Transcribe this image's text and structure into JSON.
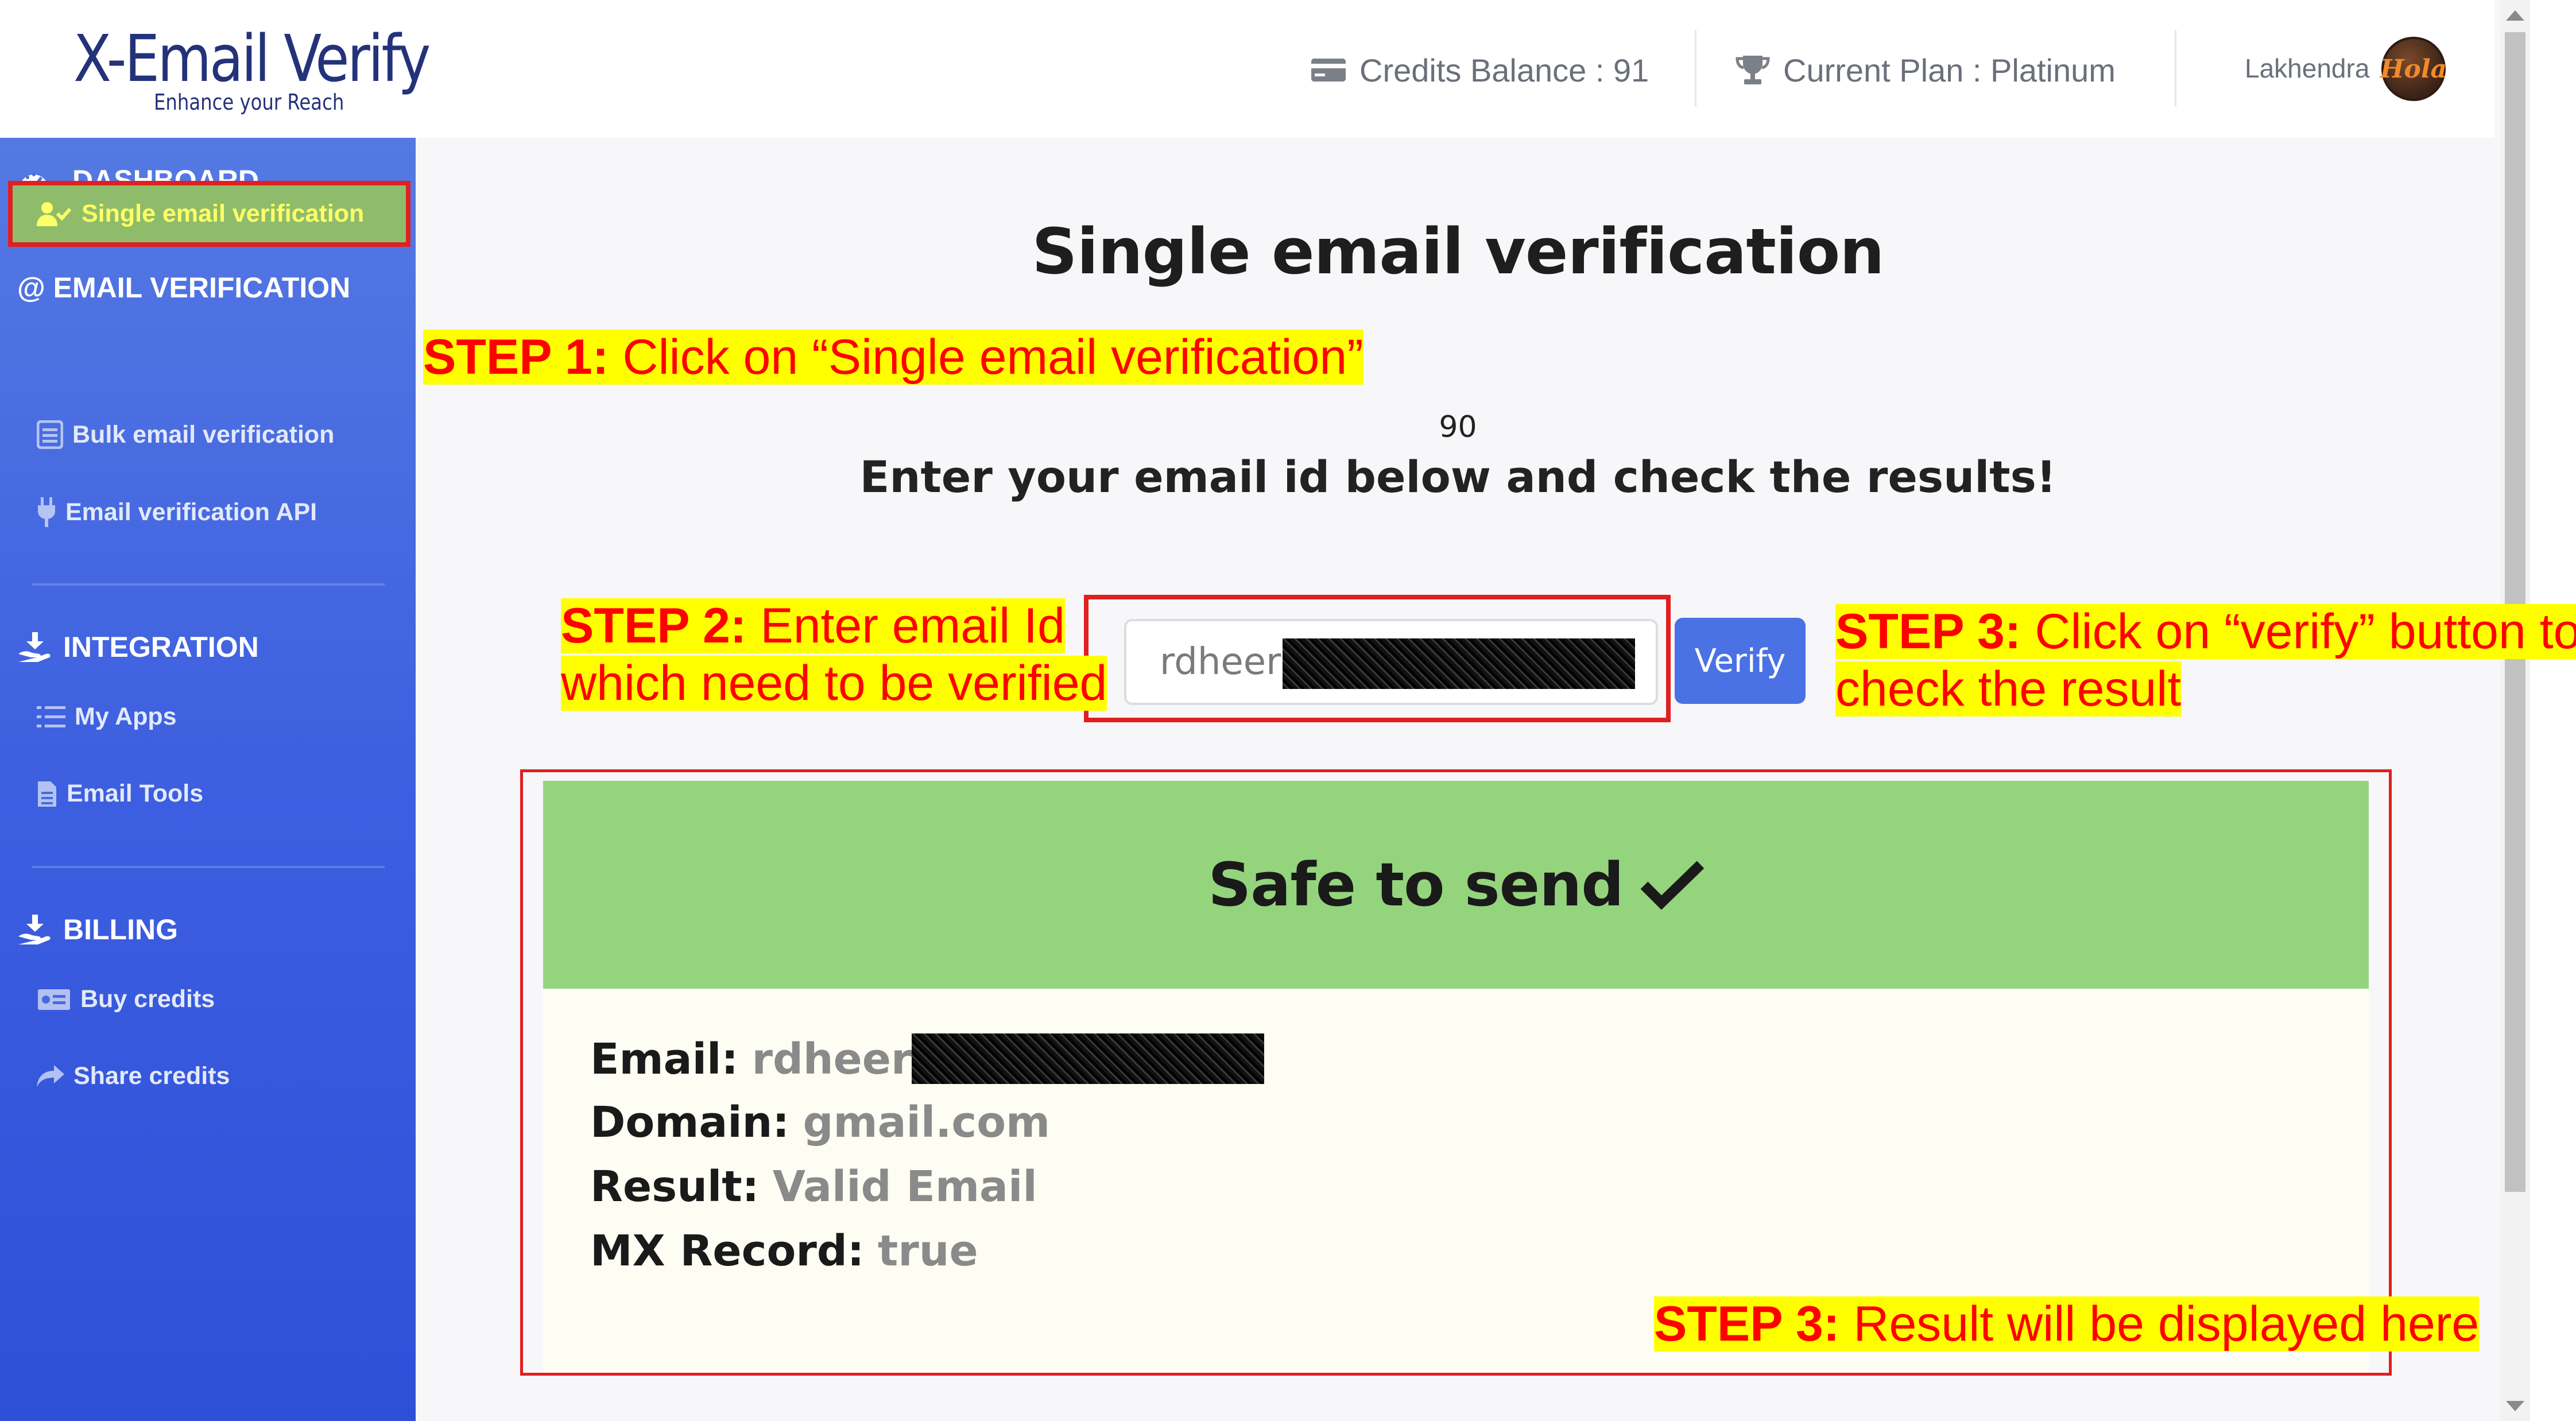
{
  "header": {
    "logo_main": "X-Email Verify",
    "logo_tagline": "Enhance your Reach",
    "credits_label": "Credits Balance : 91",
    "plan_label": "Current Plan : Platinum",
    "user_name": "Lakhendra",
    "avatar_text": "Hola"
  },
  "sidebar": {
    "dashboard": "DASHBOARD",
    "email_verification_heading": "@ EMAIL VERIFICATION",
    "items_email": [
      {
        "label": "Single email verification",
        "icon": "user-check-icon",
        "active": true
      },
      {
        "label": "Bulk email verification",
        "icon": "list-icon"
      },
      {
        "label": "Email verification API",
        "icon": "plug-icon"
      }
    ],
    "integration_heading": "INTEGRATION",
    "items_integration": [
      {
        "label": "My Apps",
        "icon": "list-check-icon"
      },
      {
        "label": "Email Tools",
        "icon": "file-icon"
      }
    ],
    "billing_heading": "BILLING",
    "items_billing": [
      {
        "label": "Buy credits",
        "icon": "money-icon"
      },
      {
        "label": "Share credits",
        "icon": "share-icon"
      }
    ]
  },
  "main": {
    "title": "Single email verification",
    "counter": "90",
    "subtitle": "Enter your email id below and check the results!",
    "email_value": "rdheer",
    "verify_label": "Verify",
    "result": {
      "banner": "Safe to send",
      "email_label": "Email:",
      "email_value": "rdheer",
      "domain_label": "Domain:",
      "domain_value": "gmail.com",
      "result_label": "Result:",
      "result_value": "Valid Email",
      "mx_label": "MX Record:",
      "mx_value": "true"
    }
  },
  "annotations": {
    "step1_prefix": "STEP 1:",
    "step1_text": " Click on “Single email verification”",
    "step2_prefix": "STEP 2:",
    "step2_line1": " Enter email Id",
    "step2_line2": "which need to be verified",
    "step3_prefix": "STEP 3:",
    "step3_line1": " Click on “verify” button to",
    "step3_line2": "check the result",
    "step3b_prefix": "STEP 3:",
    "step3b_text": " Result will be displayed here"
  },
  "colors": {
    "sidebar_top": "#5579e2",
    "sidebar_bottom": "#2f4fd8",
    "verify_button": "#4a72e4",
    "result_banner": "#94d47d",
    "annotation_red": "#ff0000",
    "annotation_highlight": "#ffff00"
  }
}
